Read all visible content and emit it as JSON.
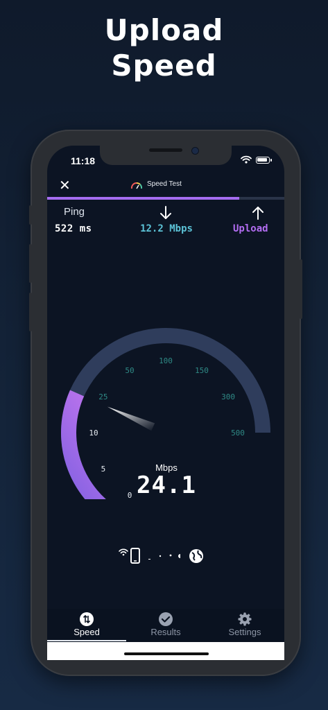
{
  "promo": {
    "line1": "Upload",
    "line2": "Speed"
  },
  "status_bar": {
    "time": "11:18",
    "wifi_icon": "wifi-icon",
    "battery_icon": "battery-icon"
  },
  "header": {
    "close_icon": "✕",
    "title": "Speed Test",
    "progress_fraction": 0.81,
    "accent_color": "#a56cf0"
  },
  "metrics": {
    "ping_label": "Ping",
    "ping_value": "522 ms",
    "download_value": "12.2 Mbps",
    "upload_label": "Upload",
    "download_color": "#5cc2d6",
    "upload_color": "#b36df2"
  },
  "gauge": {
    "ticks": [
      "0",
      "5",
      "10",
      "25",
      "50",
      "100",
      "150",
      "300",
      "500"
    ],
    "unit": "Mbps",
    "value_display": "24.1",
    "needle_value": 22,
    "track_color": "#2f3d5c",
    "fill_color": "#8f5fe6"
  },
  "connection": {
    "icons": [
      "wifi-icon",
      "phone-icon",
      "dots",
      "globe-icon"
    ]
  },
  "tabs": [
    {
      "label": "Speed",
      "icon": "speed-icon",
      "active": true
    },
    {
      "label": "Results",
      "icon": "check-circle-icon",
      "active": false
    },
    {
      "label": "Settings",
      "icon": "gear-icon",
      "active": false
    }
  ]
}
